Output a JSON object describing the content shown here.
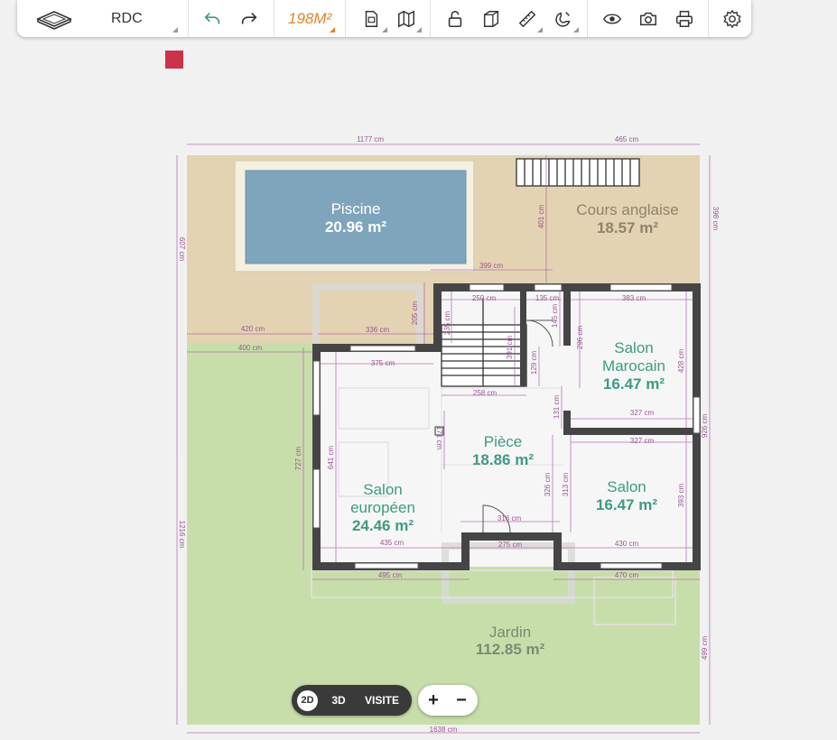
{
  "toolbar": {
    "floor": "RDC",
    "area": "198M²",
    "icons": [
      "floor-plan-icon",
      "undo-icon",
      "redo-icon",
      "document-icon",
      "map-icon",
      "unlock-icon",
      "cube-icon",
      "ruler-icon",
      "magnet-icon",
      "eye-icon",
      "camera-icon",
      "printer-icon",
      "gear-icon"
    ]
  },
  "colors": {
    "accent": "#e5822a",
    "room_text": "#3f9a83",
    "wall": "#454545",
    "terrace": "#e3d3b3",
    "garden": "#c8deaa",
    "pool": "#7ea5bc",
    "dimension": "#b060a8",
    "marker": "#cc3349"
  },
  "rooms": {
    "piscine": {
      "name": "Piscine",
      "area": "20.96 m²"
    },
    "cours": {
      "name": "Cours anglaise",
      "area": "18.57 m²"
    },
    "marocain": {
      "name1": "Salon",
      "name2": "Marocain",
      "area": "16.47 m²"
    },
    "piece": {
      "name": "Pièce",
      "area": "18.86 m²"
    },
    "salon": {
      "name": "Salon",
      "area": "16.47 m²"
    },
    "europeen": {
      "name1": "Salon",
      "name2": "européen",
      "area": "24.46 m²"
    },
    "jardin": {
      "name": "Jardin",
      "area": "112.85 m²"
    }
  },
  "dimensions": {
    "top_total": "1177 cm",
    "top_right": "465 cm",
    "right_top": "398 cm",
    "left_top": "607 cm",
    "left_bottom": "1216 cm",
    "bottom_total": "1638 cm",
    "right_bottom": "499 cm",
    "right_house": "926 cm",
    "d420": "420 cm",
    "d400": "400 cm",
    "d336": "336 cm",
    "d205": "205 cm",
    "d399": "399 cm",
    "d401": "401 cm",
    "d250": "250 cm",
    "d135": "135 cm",
    "d383": "383 cm",
    "d145": "145 cm",
    "d296": "296 cm",
    "d428": "428 cm",
    "d375": "375 cm",
    "d391": "391 cm",
    "d129": "129 cm",
    "d258": "258 cm",
    "d131": "131 cm",
    "d327a": "327 cm",
    "d327b": "327 cm",
    "d727": "727 cm",
    "d641": "641 cm",
    "d171": "171 cm",
    "d326": "326 cm",
    "d313": "313 cm",
    "d393": "393 cm",
    "d316": "316 cm",
    "d435": "435 cm",
    "d275": "275 cm",
    "d430": "430 cm",
    "d495": "495 cm",
    "d470": "470 cm",
    "d235": "235 cm"
  },
  "view_modes": {
    "d2": "2D",
    "d3": "3D",
    "visite": "VISITE"
  },
  "zoom": {
    "plus": "+",
    "minus": "−"
  }
}
